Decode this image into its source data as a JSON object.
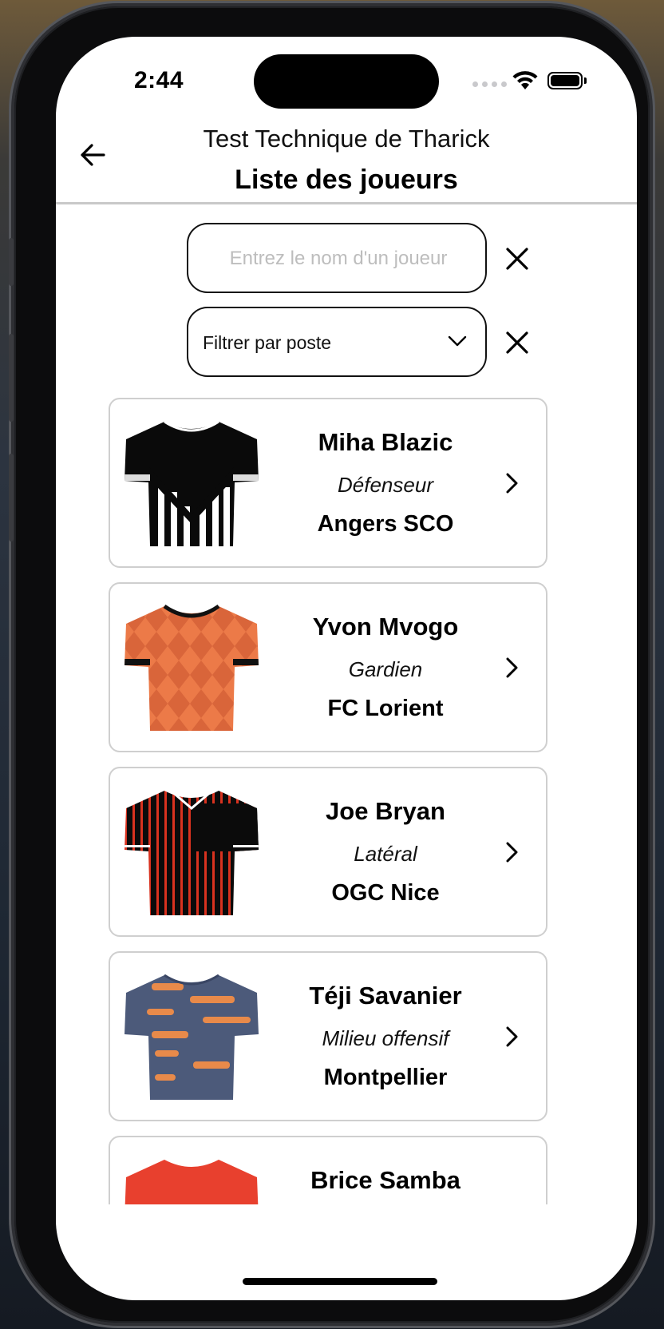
{
  "status_bar": {
    "time": "2:44"
  },
  "header": {
    "subtitle": "Test Technique de Tharick",
    "title": "Liste des joueurs",
    "back_icon": "arrow-left-icon"
  },
  "search": {
    "placeholder": "Entrez le nom d'un joueur",
    "value": ""
  },
  "filter": {
    "label": "Filtrer par poste",
    "chevron_icon": "chevron-down-icon"
  },
  "players": [
    {
      "name": "Miha Blazic",
      "position": "Défenseur",
      "club": "Angers SCO",
      "jersey": "black-white-stripes"
    },
    {
      "name": "Yvon Mvogo",
      "position": "Gardien",
      "club": "FC Lorient",
      "jersey": "orange-checker"
    },
    {
      "name": "Joe Bryan",
      "position": "Latéral",
      "club": "OGC Nice",
      "jersey": "black-red-stripes"
    },
    {
      "name": "Téji Savanier",
      "position": "Milieu offensif",
      "club": "Montpellier",
      "jersey": "navy-orange"
    },
    {
      "name": "Brice Samba",
      "position": "",
      "club": "",
      "jersey": "red"
    }
  ],
  "colors": {
    "accent": "#000000",
    "card_border": "#cfcfcf",
    "placeholder": "#bdbdbd"
  }
}
